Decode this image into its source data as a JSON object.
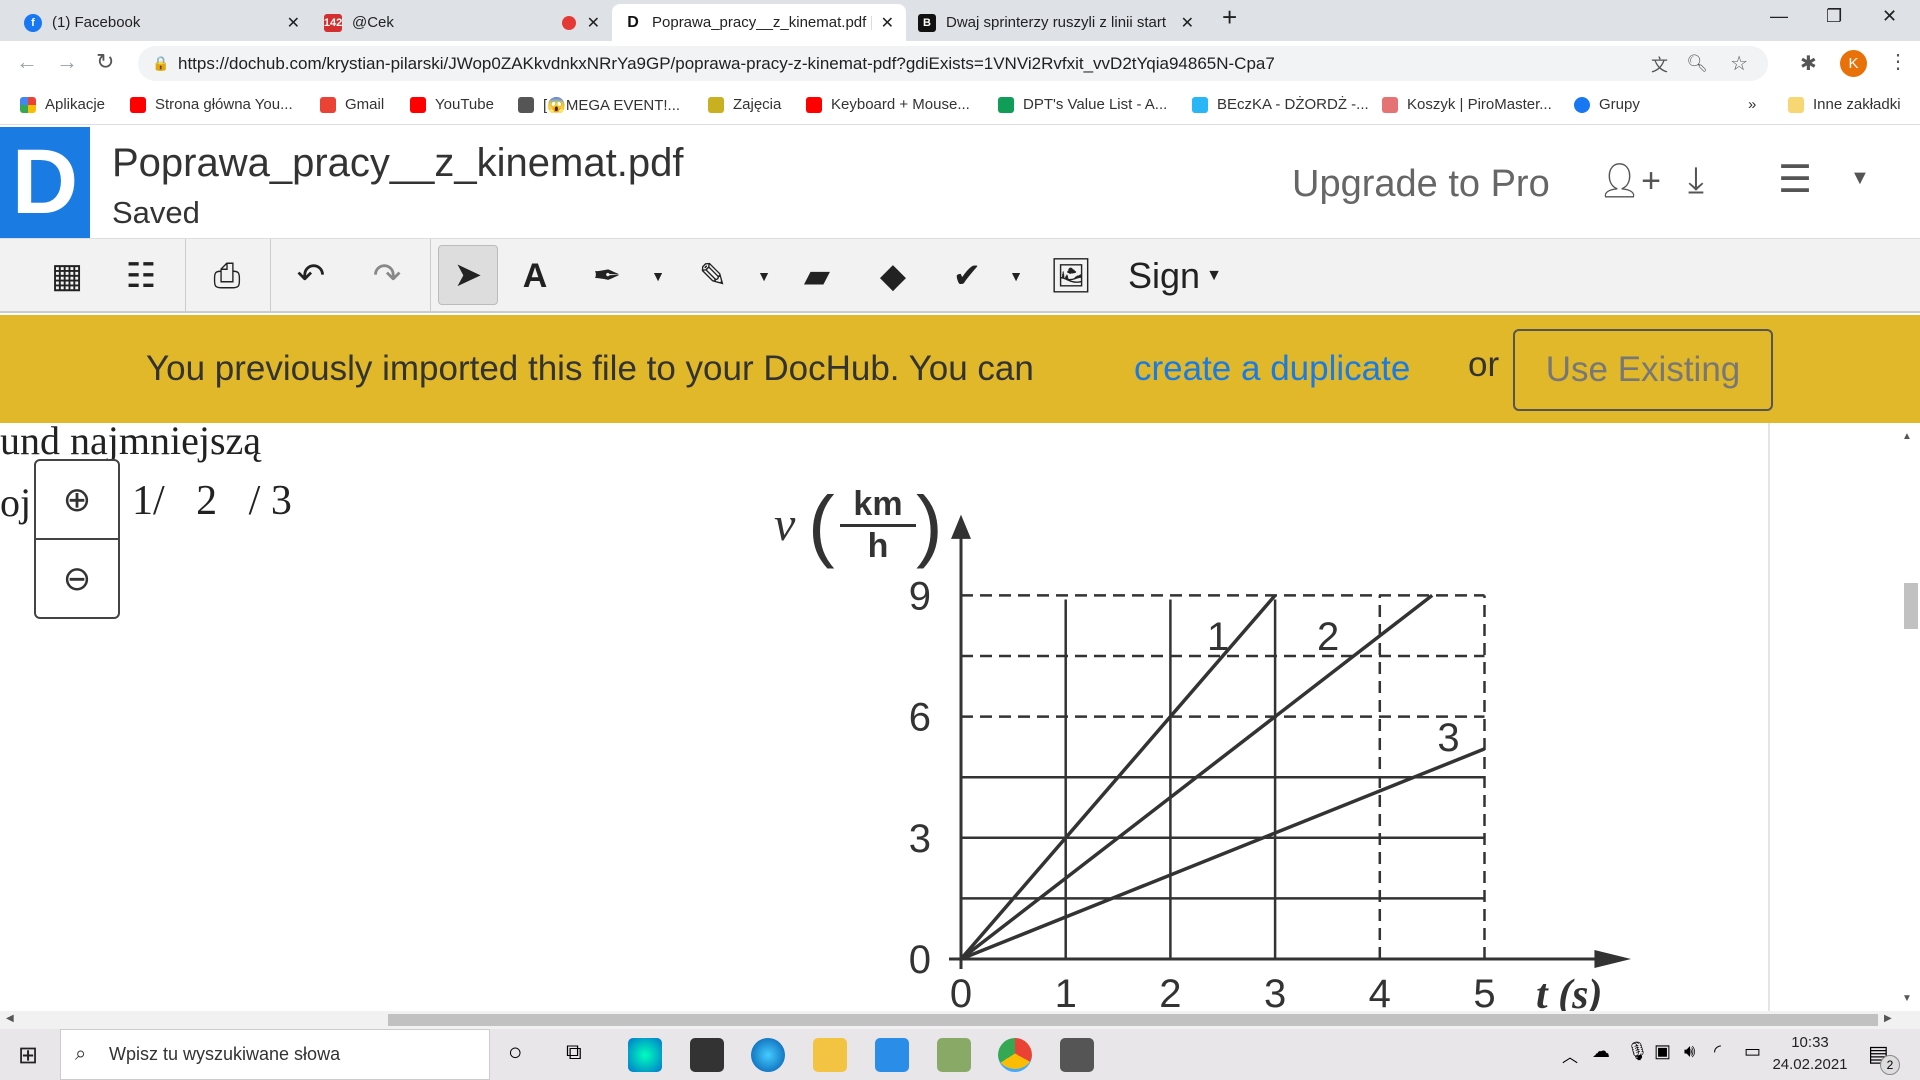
{
  "browser": {
    "tabs": [
      {
        "title": "(1) Facebook",
        "icon": "facebook-icon",
        "color": "#1877f2"
      },
      {
        "title": "@Cek",
        "icon": "calendar-142-icon",
        "color": "#d32f2f"
      },
      {
        "title": "Poprawa_pracy__z_kinemat.pdf | D",
        "icon": "dochub-icon",
        "active": true
      },
      {
        "title": "Dwaj sprinterzy ruszyli z linii start",
        "icon": "brainly-icon",
        "color": "#111"
      }
    ],
    "url": "https://dochub.com/krystian-pilarski/JWop0ZAKkvdnkxNRrYa9GP/poprawa-pracy-z-kinemat-pdf?gdiExists=1VNVi2Rvfxit_vvD2tYqia94865N-Cpa7",
    "profile_initial": "K",
    "bookmarks": [
      "Aplikacje",
      "Strona główna You...",
      "Gmail",
      "YouTube",
      "[😱MEGA EVENT!...",
      "Zajęcia",
      "Keyboard + Mouse...",
      "DPT's Value List - A...",
      "BEczKA - DŻORDŻ -...",
      "Koszyk | PiroMaster...",
      "Grupy"
    ],
    "bookmarks_overflow": "»",
    "other_bookmarks": "Inne zakładki"
  },
  "dochub": {
    "filename": "Poprawa_pracy__z_kinemat.pdf",
    "status": "Saved",
    "upgrade": "Upgrade to Pro",
    "sign": "Sign",
    "brand_color": "#1a7be3",
    "banner": {
      "text": "You previously imported this file to your DocHub. You can",
      "link": "create a duplicate",
      "or": "or",
      "button": "Use Existing",
      "color": "#e0b829"
    }
  },
  "pdf": {
    "line1": "und najmniejszą",
    "line2": "oj",
    "line2b": "1/   2   / 3",
    "graph": {
      "ylabel_v": "v",
      "ylabel_num": "km",
      "ylabel_den": "h",
      "xlabel": "t (s)",
      "xticks": [
        "0",
        "1",
        "2",
        "3",
        "4",
        "5"
      ],
      "yticks": [
        "0",
        "3",
        "6",
        "9"
      ],
      "line_labels": [
        "1",
        "2",
        "3"
      ],
      "lines": [
        [
          [
            0,
            0
          ],
          [
            3,
            9
          ]
        ],
        [
          [
            0,
            0
          ],
          [
            4.5,
            9
          ]
        ],
        [
          [
            0,
            0
          ],
          [
            5,
            5.2
          ]
        ]
      ]
    }
  },
  "taskbar": {
    "search": "Wpisz tu wyszukiwane słowa",
    "time": "10:33",
    "date": "24.02.2021",
    "notifications": "2"
  }
}
